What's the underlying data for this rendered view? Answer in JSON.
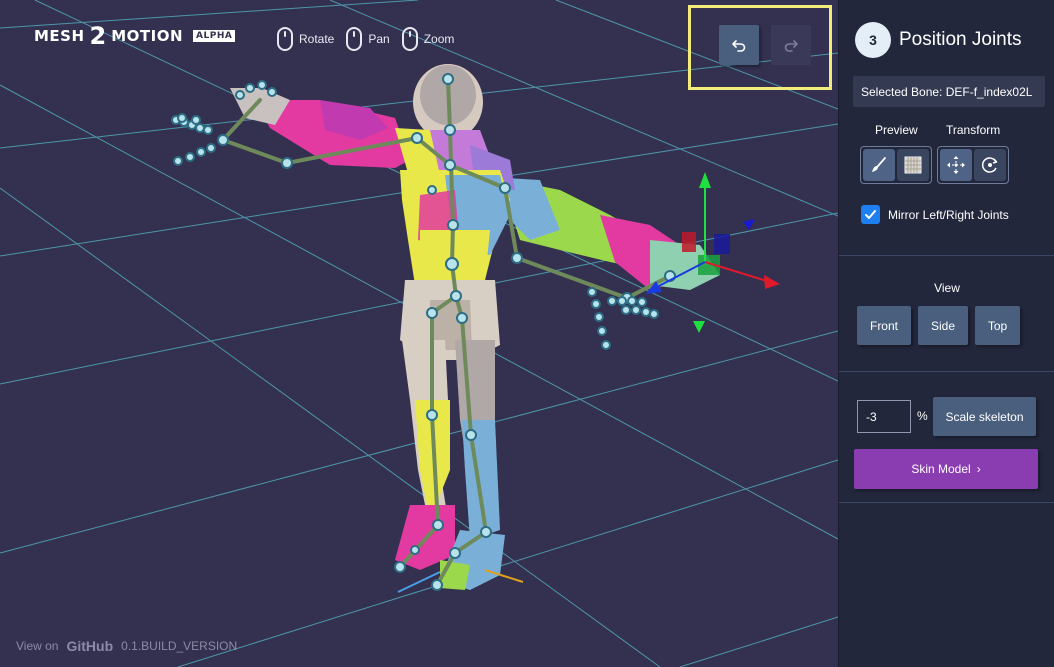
{
  "app": {
    "logo_word1": "MESH",
    "logo_num": "2",
    "logo_word2": "MOTION",
    "logo_badge": "ALPHA"
  },
  "hints": [
    {
      "icon": "mouse-left-icon",
      "label": "Rotate"
    },
    {
      "icon": "mouse-middle-icon",
      "label": "Pan"
    },
    {
      "icon": "mouse-wheel-icon",
      "label": "Zoom"
    }
  ],
  "history": {
    "undo_icon": "undo-icon",
    "redo_icon": "redo-icon"
  },
  "footer": {
    "view_on": "View on",
    "github": "GitHub",
    "version": "0.1.BUILD_VERSION"
  },
  "panel": {
    "step_number": "3",
    "step_title": "Position Joints",
    "selected_bone": "Selected Bone: DEF-f_index02L",
    "preview_label": "Preview",
    "transform_label": "Transform",
    "mirror_label": "Mirror Left/Right Joints",
    "mirror_checked": true,
    "view_label": "View",
    "view_buttons": [
      "Front",
      "Side",
      "Top"
    ],
    "scale_value": "-3",
    "scale_unit": "%",
    "scale_button": "Scale skeleton",
    "skin_button": "Skin Model",
    "skin_arrow": "›"
  },
  "colors": {
    "viewport_bg": "#343150",
    "panel_bg": "#23273c",
    "grid": "#56b8c8",
    "highlight_border": "#f3ec7a",
    "skin_button": "#8a3db0",
    "button": "#4a5f7e",
    "checkbox": "#1e7ff0"
  }
}
